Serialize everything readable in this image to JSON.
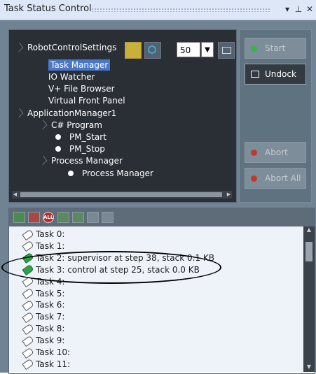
{
  "window": {
    "title": "Task Status Control",
    "buttons": {
      "dropdown": "▾",
      "pin": "⊥",
      "close": "✕"
    }
  },
  "tree": {
    "items": [
      {
        "label": "RobotControlSettings",
        "level": 0,
        "expandable": true
      },
      {
        "label": "Task Manager",
        "level": 1,
        "selected": true
      },
      {
        "label": "IO Watcher",
        "level": 1
      },
      {
        "label": "V+ File Browser",
        "level": 1
      },
      {
        "label": "Virtual Front Panel",
        "level": 1
      },
      {
        "label": "ApplicationManager1",
        "level": 0,
        "expandable": true
      },
      {
        "label": "C# Program",
        "level": 1,
        "expandable": true
      },
      {
        "label": "PM_Start",
        "level": 2,
        "bullet": true
      },
      {
        "label": "PM_Stop",
        "level": 2,
        "bullet": true
      },
      {
        "label": "Process Manager",
        "level": 1,
        "expandable": true
      },
      {
        "label": "Process Manager",
        "level": 2,
        "bullet": true
      }
    ]
  },
  "toolbar": {
    "speed_value": "50",
    "speed_arrow": "▼",
    "icons": [
      "wrench-off-icon",
      "power-icon",
      "monitor-icon"
    ]
  },
  "actions": {
    "start": "Start",
    "undock": "Undock",
    "abort": "Abort",
    "abort_all": "Abort All"
  },
  "task_toolbar": {
    "all_label": "ALL"
  },
  "tasks": [
    {
      "label": "Task 0:",
      "active": false
    },
    {
      "label": "Task 1:",
      "active": false
    },
    {
      "label": "Task 2: supervisor at step 38, stack 0.1 KB",
      "active": true
    },
    {
      "label": "Task 3: control at step 25, stack 0.0 KB",
      "active": true
    },
    {
      "label": "Task 4:",
      "active": false
    },
    {
      "label": "Task 5:",
      "active": false
    },
    {
      "label": "Task 6:",
      "active": false
    },
    {
      "label": "Task 7:",
      "active": false
    },
    {
      "label": "Task 8:",
      "active": false
    },
    {
      "label": "Task 9:",
      "active": false
    },
    {
      "label": "Task 10:",
      "active": false
    },
    {
      "label": "Task 11:",
      "active": false
    }
  ],
  "colors": {
    "panel_bg": "#6f8392",
    "tree_bg": "#2a2f36",
    "selection": "#4a78c7",
    "active_task": "#2ea24a",
    "abort_red": "#c0392b",
    "start_green": "#3db04a"
  }
}
